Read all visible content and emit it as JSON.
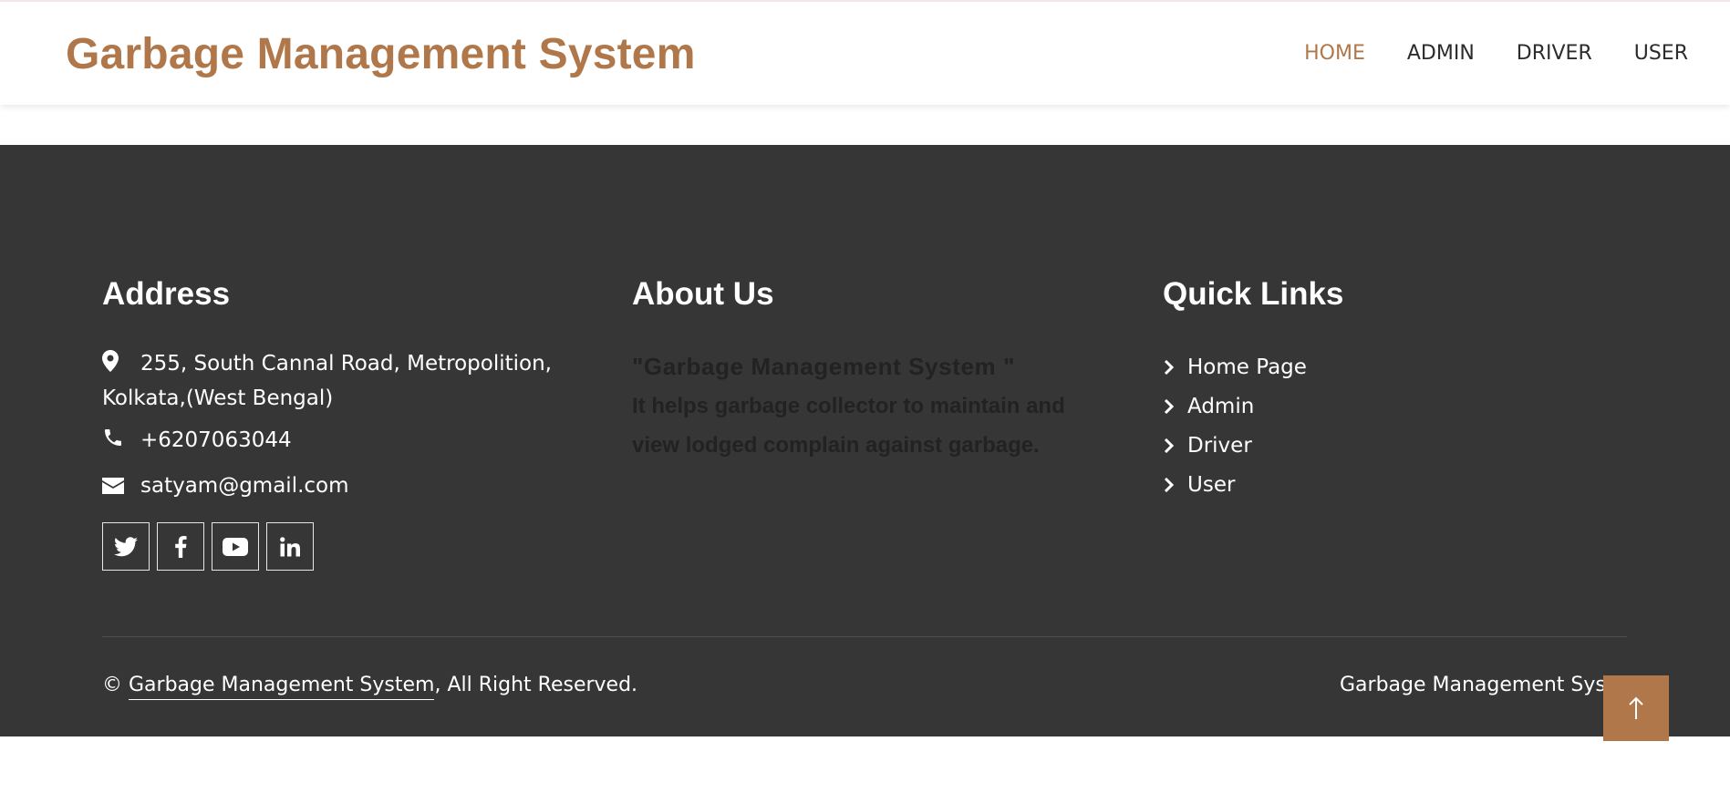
{
  "header": {
    "brand": "Garbage Management System",
    "nav": [
      {
        "label": "HOME",
        "active": true
      },
      {
        "label": "ADMIN",
        "active": false
      },
      {
        "label": "DRIVER",
        "active": false
      },
      {
        "label": "USER",
        "active": false
      }
    ]
  },
  "footer": {
    "address": {
      "heading": "Address",
      "location": "255, South Cannal Road, Metropolition, Kolkata,(West Bengal)",
      "phone": "+6207063044",
      "email": "satyam@gmail.com",
      "socials": [
        "twitter-icon",
        "facebook-icon",
        "youtube-icon",
        "linkedin-icon"
      ]
    },
    "about": {
      "heading": "About Us",
      "title": "\"Garbage Management System \"",
      "text": "It helps garbage collector to maintain and view lodged complain against garbage."
    },
    "quick_links": {
      "heading": "Quick Links",
      "items": [
        "Home Page",
        "Admin",
        "Driver",
        "User"
      ]
    },
    "copyright_symbol": "©",
    "copyright_link": "Garbage Management System",
    "copyright_suffix": ", All Right Reserved.",
    "right_credit": "Garbage Management Syste"
  },
  "colors": {
    "accent": "#b0784a",
    "footer_bg": "#363636"
  }
}
